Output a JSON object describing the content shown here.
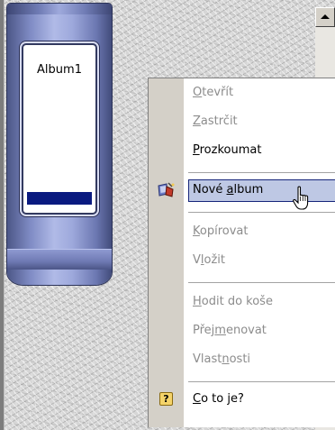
{
  "album": {
    "label": "Album1"
  },
  "context_menu": {
    "items": [
      {
        "pre": "",
        "acc": "O",
        "post": "tevřít",
        "disabled": true
      },
      {
        "pre": "",
        "acc": "Z",
        "post": "astrčit",
        "disabled": true
      },
      {
        "pre": "",
        "acc": "P",
        "post": "rozkoumat",
        "disabled": false
      },
      {
        "pre": "Nové ",
        "acc": "a",
        "post": "lbum",
        "disabled": false,
        "selected": true,
        "icon": "album-wand-icon"
      },
      {
        "pre": "",
        "acc": "K",
        "post": "opírovat",
        "disabled": true
      },
      {
        "pre": "V",
        "acc": "l",
        "post": "ožit",
        "disabled": true
      },
      {
        "pre": "",
        "acc": "H",
        "post": "odit do koše",
        "disabled": true
      },
      {
        "pre": "Přej",
        "acc": "m",
        "post": "enovat",
        "disabled": true
      },
      {
        "pre": "Vlast",
        "acc": "n",
        "post": "osti",
        "disabled": true
      },
      {
        "pre": "",
        "acc": "C",
        "post": "o to je?",
        "disabled": false,
        "icon": "help-icon"
      }
    ],
    "help_icon_glyph": "?"
  },
  "colors": {
    "menu_highlight": "#bec8e4",
    "menu_highlight_border": "#16257a",
    "album_bar": "#0a1a80",
    "disabled_text": "#8c8c8c"
  }
}
